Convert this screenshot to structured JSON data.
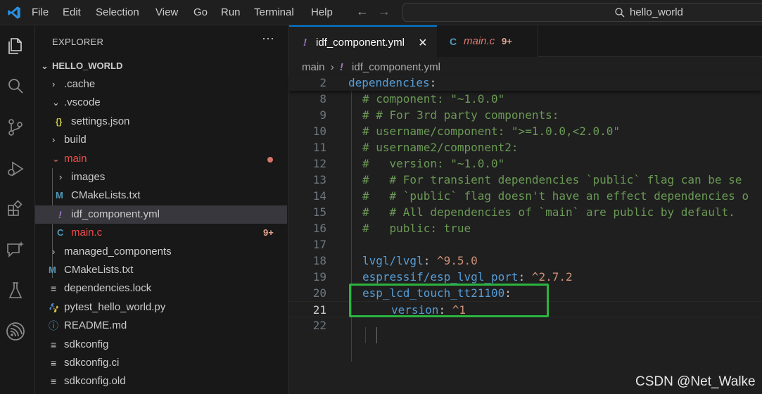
{
  "menu": [
    "File",
    "Edit",
    "Selection",
    "View",
    "Go",
    "Run",
    "Terminal",
    "Help"
  ],
  "search": {
    "text": "hello_world"
  },
  "explorer": {
    "title": "EXPLORER",
    "more": "···",
    "project": "HELLO_WORLD",
    "items": [
      {
        "name": ".cache",
        "type": "folder",
        "expanded": false
      },
      {
        "name": ".vscode",
        "type": "folder",
        "expanded": true
      },
      {
        "name": "settings.json",
        "type": "json",
        "icon": "{}"
      },
      {
        "name": "build",
        "type": "folder",
        "expanded": false
      },
      {
        "name": "main",
        "type": "folder",
        "expanded": true
      },
      {
        "name": "images",
        "type": "folder",
        "expanded": false
      },
      {
        "name": "CMakeLists.txt",
        "type": "cmake",
        "icon": "M"
      },
      {
        "name": "idf_component.yml",
        "type": "yaml",
        "icon": "!"
      },
      {
        "name": "main.c",
        "type": "c",
        "icon": "C",
        "badge": "9+"
      },
      {
        "name": "managed_components",
        "type": "folder",
        "expanded": false
      },
      {
        "name": "CMakeLists.txt",
        "type": "cmake",
        "icon": "M"
      },
      {
        "name": "dependencies.lock",
        "type": "text",
        "icon": "≡"
      },
      {
        "name": "pytest_hello_world.py",
        "type": "python",
        "icon": "🐍"
      },
      {
        "name": "README.md",
        "type": "info",
        "icon": "ⓘ"
      },
      {
        "name": "sdkconfig",
        "type": "text",
        "icon": "≡"
      },
      {
        "name": "sdkconfig.ci",
        "type": "text",
        "icon": "≡"
      },
      {
        "name": "sdkconfig.old",
        "type": "text",
        "icon": "≡"
      }
    ]
  },
  "tabs": [
    {
      "icon": "!",
      "label": "idf_component.yml",
      "close": "×"
    },
    {
      "icon": "C",
      "label": "main.c",
      "badge": "9+"
    }
  ],
  "breadcrumbs": {
    "folder": "main",
    "separator": "›",
    "icon": "!",
    "file": "idf_component.yml"
  },
  "code": {
    "sticky": {
      "ln": "2",
      "key": "dependencies",
      "punc": ":"
    },
    "lines": [
      {
        "ln": "8",
        "text": "# component: \"~1.0.0\""
      },
      {
        "ln": "9",
        "text": "# # For 3rd party components:"
      },
      {
        "ln": "10",
        "text": "# username/component: \">=1.0.0,<2.0.0\""
      },
      {
        "ln": "11",
        "text": "# username2/component2:"
      },
      {
        "ln": "12",
        "text": "#   version: \"~1.0.0\""
      },
      {
        "ln": "13",
        "text": "#   # For transient dependencies `public` flag can be se"
      },
      {
        "ln": "14",
        "text": "#   # `public` flag doesn't have an effect dependencies o"
      },
      {
        "ln": "15",
        "text": "#   # All dependencies of `main` are public by default."
      },
      {
        "ln": "16",
        "text": "#   public: true"
      },
      {
        "ln": "17",
        "text": ""
      },
      {
        "ln": "18",
        "key": "lvgl/lvgl",
        "val": "^9.5.0"
      },
      {
        "ln": "19",
        "key": "espressif/esp_lvgl_port",
        "val": "^2.7.2"
      },
      {
        "ln": "20",
        "key": "esp_lcd_touch_tt21100",
        "val": ""
      },
      {
        "ln": "21",
        "key": "version",
        "val": "^1"
      },
      {
        "ln": "22",
        "text": ""
      }
    ]
  },
  "watermark": "CSDN @Net_Walke"
}
